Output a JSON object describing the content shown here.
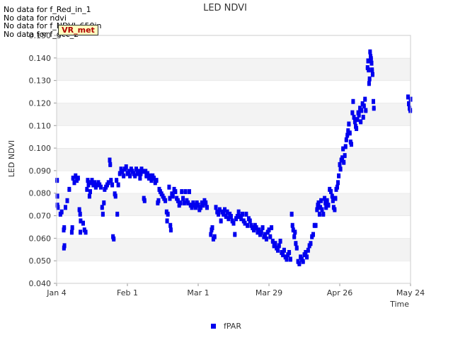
{
  "notes": [
    "No data for f_Red_in_1",
    "No data for ndvi",
    "No data for f_NDVI_650in",
    "No data for f_gcc_2"
  ],
  "badge": {
    "label": "VR_met"
  },
  "chart_data": {
    "type": "scatter",
    "title": "LED NDVI",
    "xlabel": "Time",
    "ylabel": "LED NDVI",
    "x_ticks": [
      "Jan 4",
      "Feb 1",
      "Mar 1",
      "Mar 29",
      "Apr 26",
      "May 24"
    ],
    "x_range_days": [
      0,
      140
    ],
    "ylim": [
      0.04,
      0.15
    ],
    "y_ticks": [
      0.04,
      0.05,
      0.06,
      0.07,
      0.08,
      0.09,
      0.1,
      0.11,
      0.12,
      0.13,
      0.14,
      0.15
    ],
    "legend": {
      "position": "bottom",
      "entries": [
        {
          "name": "fPAR",
          "color": "#0000ee"
        }
      ]
    },
    "grid": "horizontal bands",
    "series": [
      {
        "name": "fPAR",
        "color": "#0000ee",
        "points": [
          [
            0.2,
            0.086
          ],
          [
            0.3,
            0.079
          ],
          [
            0.3,
            0.075
          ],
          [
            0.5,
            0.074
          ],
          [
            1.5,
            0.071
          ],
          [
            2.0,
            0.072
          ],
          [
            2.8,
            0.064
          ],
          [
            3.0,
            0.065
          ],
          [
            2.9,
            0.056
          ],
          [
            3.1,
            0.057
          ],
          [
            3.5,
            0.074
          ],
          [
            4.2,
            0.077
          ],
          [
            5.0,
            0.082
          ],
          [
            6.0,
            0.063
          ],
          [
            6.2,
            0.065
          ],
          [
            6.5,
            0.087
          ],
          [
            7.0,
            0.085
          ],
          [
            7.5,
            0.088
          ],
          [
            8.0,
            0.086
          ],
          [
            8.5,
            0.087
          ],
          [
            9.0,
            0.073
          ],
          [
            9.3,
            0.071
          ],
          [
            9.5,
            0.068
          ],
          [
            9.4,
            0.063
          ],
          [
            10.5,
            0.067
          ],
          [
            11.0,
            0.064
          ],
          [
            11.5,
            0.063
          ],
          [
            12.0,
            0.082
          ],
          [
            12.3,
            0.086
          ],
          [
            12.6,
            0.084
          ],
          [
            13.0,
            0.079
          ],
          [
            13.3,
            0.081
          ],
          [
            13.7,
            0.085
          ],
          [
            14.0,
            0.086
          ],
          [
            14.5,
            0.084
          ],
          [
            15.0,
            0.085
          ],
          [
            15.5,
            0.083
          ],
          [
            16.0,
            0.084
          ],
          [
            16.5,
            0.085
          ],
          [
            17.0,
            0.084
          ],
          [
            17.5,
            0.083
          ],
          [
            18.0,
            0.074
          ],
          [
            18.3,
            0.071
          ],
          [
            18.7,
            0.076
          ],
          [
            19.0,
            0.082
          ],
          [
            19.5,
            0.083
          ],
          [
            20.0,
            0.084
          ],
          [
            20.5,
            0.085
          ],
          [
            21.0,
            0.095
          ],
          [
            21.2,
            0.093
          ],
          [
            21.5,
            0.086
          ],
          [
            22.0,
            0.084
          ],
          [
            22.3,
            0.061
          ],
          [
            22.6,
            0.06
          ],
          [
            23.0,
            0.08
          ],
          [
            23.3,
            0.079
          ],
          [
            23.7,
            0.086
          ],
          [
            24.0,
            0.071
          ],
          [
            24.4,
            0.084
          ],
          [
            25.0,
            0.089
          ],
          [
            25.5,
            0.091
          ],
          [
            26.0,
            0.09
          ],
          [
            26.5,
            0.088
          ],
          [
            27.0,
            0.091
          ],
          [
            27.5,
            0.092
          ],
          [
            28.0,
            0.089
          ],
          [
            28.5,
            0.09
          ],
          [
            29.0,
            0.088
          ],
          [
            29.5,
            0.091
          ],
          [
            30.0,
            0.09
          ],
          [
            30.5,
            0.089
          ],
          [
            31.0,
            0.088
          ],
          [
            31.5,
            0.091
          ],
          [
            32.0,
            0.089
          ],
          [
            32.5,
            0.09
          ],
          [
            33.0,
            0.087
          ],
          [
            33.3,
            0.089
          ],
          [
            33.6,
            0.091
          ],
          [
            34.0,
            0.09
          ],
          [
            34.5,
            0.078
          ],
          [
            34.8,
            0.077
          ],
          [
            35.2,
            0.09
          ],
          [
            35.5,
            0.088
          ],
          [
            36.0,
            0.089
          ],
          [
            36.5,
            0.087
          ],
          [
            37.0,
            0.088
          ],
          [
            37.5,
            0.086
          ],
          [
            38.0,
            0.088
          ],
          [
            38.5,
            0.087
          ],
          [
            39.0,
            0.085
          ],
          [
            39.5,
            0.086
          ],
          [
            40.0,
            0.076
          ],
          [
            40.3,
            0.077
          ],
          [
            40.6,
            0.082
          ],
          [
            41.0,
            0.081
          ],
          [
            41.5,
            0.08
          ],
          [
            42.0,
            0.079
          ],
          [
            42.5,
            0.078
          ],
          [
            43.0,
            0.077
          ],
          [
            43.5,
            0.072
          ],
          [
            43.7,
            0.068
          ],
          [
            44.0,
            0.071
          ],
          [
            44.5,
            0.083
          ],
          [
            44.8,
            0.078
          ],
          [
            45.0,
            0.066
          ],
          [
            45.2,
            0.064
          ],
          [
            45.6,
            0.08
          ],
          [
            46.0,
            0.079
          ],
          [
            46.5,
            0.082
          ],
          [
            47.0,
            0.081
          ],
          [
            47.5,
            0.078
          ],
          [
            48.0,
            0.077
          ],
          [
            48.5,
            0.075
          ],
          [
            49.0,
            0.076
          ],
          [
            49.5,
            0.081
          ],
          [
            50.0,
            0.078
          ],
          [
            50.5,
            0.076
          ],
          [
            51.0,
            0.081
          ],
          [
            51.5,
            0.077
          ],
          [
            52.0,
            0.076
          ],
          [
            52.5,
            0.081
          ],
          [
            53.0,
            0.075
          ],
          [
            53.5,
            0.074
          ],
          [
            54.0,
            0.076
          ],
          [
            54.5,
            0.075
          ],
          [
            55.0,
            0.074
          ],
          [
            55.5,
            0.076
          ],
          [
            56.0,
            0.075
          ],
          [
            56.5,
            0.073
          ],
          [
            57.0,
            0.074
          ],
          [
            57.5,
            0.076
          ],
          [
            58.0,
            0.075
          ],
          [
            58.5,
            0.077
          ],
          [
            59.0,
            0.076
          ],
          [
            59.5,
            0.074
          ],
          [
            61.0,
            0.062
          ],
          [
            61.3,
            0.064
          ],
          [
            61.6,
            0.065
          ],
          [
            62.0,
            0.06
          ],
          [
            62.5,
            0.061
          ],
          [
            63.0,
            0.074
          ],
          [
            63.5,
            0.072
          ],
          [
            64.0,
            0.071
          ],
          [
            64.5,
            0.073
          ],
          [
            65.0,
            0.068
          ],
          [
            65.5,
            0.072
          ],
          [
            66.0,
            0.071
          ],
          [
            66.5,
            0.073
          ],
          [
            67.0,
            0.07
          ],
          [
            67.5,
            0.072
          ],
          [
            68.0,
            0.069
          ],
          [
            68.5,
            0.071
          ],
          [
            69.0,
            0.07
          ],
          [
            69.5,
            0.068
          ],
          [
            70.0,
            0.067
          ],
          [
            70.5,
            0.062
          ],
          [
            71.0,
            0.069
          ],
          [
            71.5,
            0.07
          ],
          [
            72.0,
            0.072
          ],
          [
            72.5,
            0.07
          ],
          [
            73.0,
            0.069
          ],
          [
            73.5,
            0.071
          ],
          [
            74.0,
            0.068
          ],
          [
            74.5,
            0.067
          ],
          [
            75.0,
            0.071
          ],
          [
            75.5,
            0.066
          ],
          [
            76.0,
            0.069
          ],
          [
            76.5,
            0.068
          ],
          [
            77.0,
            0.066
          ],
          [
            77.5,
            0.065
          ],
          [
            78.0,
            0.064
          ],
          [
            78.5,
            0.066
          ],
          [
            79.0,
            0.065
          ],
          [
            79.5,
            0.063
          ],
          [
            80.0,
            0.064
          ],
          [
            80.5,
            0.062
          ],
          [
            81.0,
            0.063
          ],
          [
            81.5,
            0.065
          ],
          [
            82.0,
            0.061
          ],
          [
            82.5,
            0.062
          ],
          [
            83.0,
            0.06
          ],
          [
            83.5,
            0.063
          ],
          [
            84.0,
            0.064
          ],
          [
            84.5,
            0.061
          ],
          [
            85.0,
            0.065
          ],
          [
            85.5,
            0.059
          ],
          [
            86.0,
            0.057
          ],
          [
            86.5,
            0.058
          ],
          [
            87.0,
            0.056
          ],
          [
            87.5,
            0.055
          ],
          [
            88.0,
            0.057
          ],
          [
            88.5,
            0.059
          ],
          [
            89.0,
            0.054
          ],
          [
            89.5,
            0.053
          ],
          [
            90.0,
            0.055
          ],
          [
            90.5,
            0.052
          ],
          [
            91.0,
            0.051
          ],
          [
            91.5,
            0.053
          ],
          [
            92.0,
            0.054
          ],
          [
            92.5,
            0.051
          ],
          [
            93.0,
            0.071
          ],
          [
            93.3,
            0.066
          ],
          [
            93.6,
            0.064
          ],
          [
            94.0,
            0.061
          ],
          [
            94.3,
            0.063
          ],
          [
            94.6,
            0.058
          ],
          [
            95.0,
            0.056
          ],
          [
            95.5,
            0.05
          ],
          [
            96.0,
            0.049
          ],
          [
            96.5,
            0.052
          ],
          [
            97.0,
            0.051
          ],
          [
            97.5,
            0.05
          ],
          [
            98.0,
            0.053
          ],
          [
            98.5,
            0.054
          ],
          [
            99.0,
            0.052
          ],
          [
            99.5,
            0.055
          ],
          [
            100.0,
            0.057
          ],
          [
            100.5,
            0.058
          ],
          [
            101.0,
            0.061
          ],
          [
            101.5,
            0.062
          ],
          [
            102.0,
            0.066
          ],
          [
            102.5,
            0.066
          ],
          [
            103.0,
            0.073
          ],
          [
            103.3,
            0.075
          ],
          [
            103.6,
            0.076
          ],
          [
            104.0,
            0.071
          ],
          [
            104.3,
            0.074
          ],
          [
            104.6,
            0.077
          ],
          [
            105.0,
            0.073
          ],
          [
            105.5,
            0.071
          ],
          [
            106.0,
            0.078
          ],
          [
            106.3,
            0.076
          ],
          [
            106.6,
            0.074
          ],
          [
            107.0,
            0.077
          ],
          [
            107.5,
            0.075
          ],
          [
            108.0,
            0.082
          ],
          [
            108.5,
            0.081
          ],
          [
            109.0,
            0.079
          ],
          [
            109.3,
            0.077
          ],
          [
            109.6,
            0.074
          ],
          [
            110.0,
            0.073
          ],
          [
            110.3,
            0.078
          ],
          [
            110.6,
            0.082
          ],
          [
            111.0,
            0.083
          ],
          [
            111.3,
            0.085
          ],
          [
            111.6,
            0.088
          ],
          [
            112.0,
            0.093
          ],
          [
            112.3,
            0.091
          ],
          [
            112.6,
            0.095
          ],
          [
            113.0,
            0.096
          ],
          [
            113.3,
            0.1
          ],
          [
            113.6,
            0.094
          ],
          [
            114.0,
            0.097
          ],
          [
            114.3,
            0.101
          ],
          [
            114.6,
            0.104
          ],
          [
            115.0,
            0.106
          ],
          [
            115.3,
            0.108
          ],
          [
            115.6,
            0.111
          ],
          [
            116.0,
            0.107
          ],
          [
            116.3,
            0.103
          ],
          [
            116.6,
            0.102
          ],
          [
            117.0,
            0.116
          ],
          [
            117.3,
            0.121
          ],
          [
            117.6,
            0.114
          ],
          [
            118.0,
            0.112
          ],
          [
            118.3,
            0.11
          ],
          [
            118.6,
            0.109
          ],
          [
            119.0,
            0.113
          ],
          [
            119.3,
            0.116
          ],
          [
            119.6,
            0.115
          ],
          [
            120.0,
            0.118
          ],
          [
            120.3,
            0.112
          ],
          [
            120.6,
            0.117
          ],
          [
            121.0,
            0.12
          ],
          [
            121.3,
            0.114
          ],
          [
            121.6,
            0.119
          ],
          [
            122.0,
            0.122
          ],
          [
            122.3,
            0.117
          ],
          [
            123.0,
            0.136
          ],
          [
            123.2,
            0.139
          ],
          [
            123.4,
            0.135
          ],
          [
            123.6,
            0.129
          ],
          [
            123.8,
            0.131
          ],
          [
            124.0,
            0.143
          ],
          [
            124.2,
            0.141
          ],
          [
            124.4,
            0.14
          ],
          [
            124.6,
            0.138
          ],
          [
            124.8,
            0.135
          ],
          [
            125.0,
            0.133
          ],
          [
            125.3,
            0.121
          ],
          [
            125.5,
            0.118
          ],
          [
            139.0,
            0.123
          ],
          [
            139.3,
            0.12
          ],
          [
            139.6,
            0.118
          ],
          [
            139.9,
            0.117
          ],
          [
            140.0,
            0.122
          ]
        ]
      }
    ]
  }
}
